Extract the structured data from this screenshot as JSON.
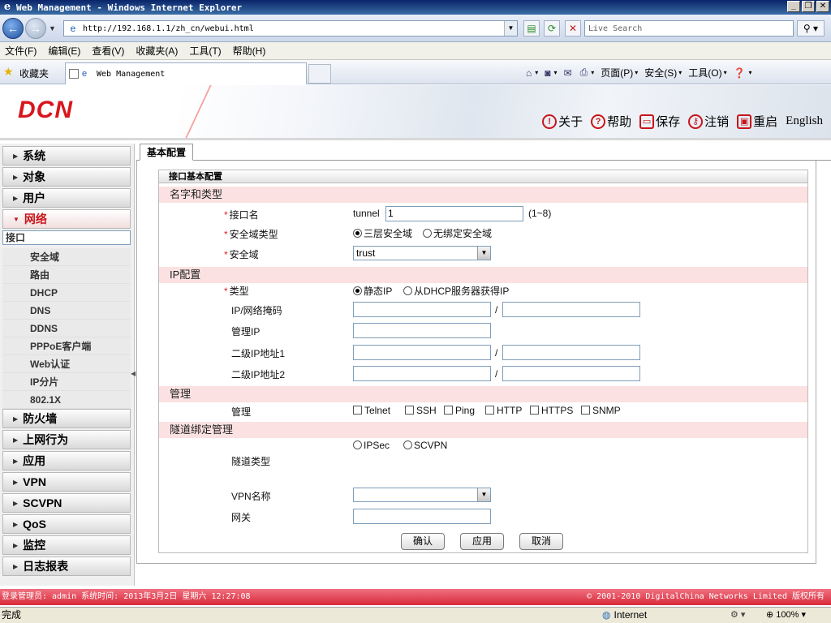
{
  "window": {
    "title": "Web Management - Windows Internet Explorer",
    "url": "http://192.168.1.1/zh_cn/webui.html",
    "search_placeholder": "Live Search",
    "tab_title": "Web Management",
    "favorites_label": "收藏夹",
    "menu": [
      "文件(F)",
      "编辑(E)",
      "查看(V)",
      "收藏夹(A)",
      "工具(T)",
      "帮助(H)"
    ],
    "commands": {
      "page": "页面(P)",
      "safety": "安全(S)",
      "tools": "工具(O)"
    }
  },
  "header": {
    "logo": "DCN",
    "links": {
      "about": "关于",
      "help": "帮助",
      "save": "保存",
      "logout": "注销",
      "reboot": "重启",
      "english": "English"
    }
  },
  "sidebar": {
    "items": [
      "系统",
      "对象",
      "用户",
      "网络",
      "防火墙",
      "上网行为",
      "应用",
      "VPN",
      "SCVPN",
      "QoS",
      "监控",
      "日志报表"
    ],
    "network_sub": [
      "接口",
      "安全域",
      "路由",
      "DHCP",
      "DNS",
      "DDNS",
      "PPPoE客户端",
      "Web认证",
      "IP分片",
      "802.1X"
    ]
  },
  "content": {
    "tab": "基本配置",
    "box_title": "接口基本配置",
    "sections": {
      "name_type": "名字和类型",
      "ip": "IP配置",
      "mgmt": "管理",
      "tunnel": "隧道绑定管理"
    },
    "labels": {
      "ifname": "接口名",
      "zone_type": "安全域类型",
      "zone": "安全域",
      "type": "类型",
      "ipmask": "IP/网络掩码",
      "mgmt_ip": "管理IP",
      "sec_ip1": "二级IP地址1",
      "sec_ip2": "二级IP地址2",
      "mgmt": "管理",
      "tunnel_type": "隧道类型",
      "vpn_name": "VPN名称",
      "gateway": "网关"
    },
    "ifname_prefix": "tunnel",
    "ifname_value": "1",
    "ifname_range": "(1~8)",
    "zone_types": [
      "三层安全域",
      "无绑定安全域"
    ],
    "zone_value": "trust",
    "ip_types": [
      "静态IP",
      "从DHCP服务器获得IP"
    ],
    "slash": "/",
    "mgmt_options": [
      "Telnet",
      "SSH",
      "Ping",
      "HTTP",
      "HTTPS",
      "SNMP"
    ],
    "tunnel_types": [
      "IPSec",
      "SCVPN"
    ],
    "buttons": {
      "ok": "确认",
      "apply": "应用",
      "cancel": "取消"
    }
  },
  "footer": {
    "left": "登录管理员: admin 系统时间: 2013年3月2日 星期六 12:27:08",
    "right": "© 2001-2010 DigitalChina Networks Limited 版权所有"
  },
  "status": {
    "done": "完成",
    "zone": "Internet",
    "zoom": "100%"
  }
}
